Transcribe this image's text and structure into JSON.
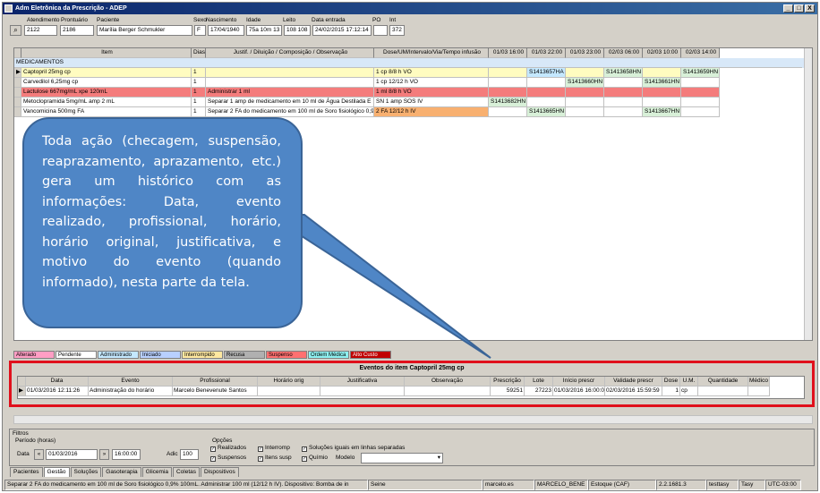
{
  "window": {
    "title": "Adm Eletrônica da Prescrição - ADEP",
    "buttons": [
      "_",
      "□",
      "X"
    ]
  },
  "patient": {
    "labels": [
      "Atendimento",
      "Prontuário",
      "Paciente",
      "Sexo",
      "Nascimento",
      "Idade",
      "Leito",
      "Data entrada",
      "PO",
      "Int"
    ],
    "values": [
      "2122",
      "2186",
      "Marília Berger Schmukler",
      "F",
      "17/04/1940",
      "75a 10m 13",
      "108 108",
      "24/02/2015 17:12:14",
      "",
      "372"
    ]
  },
  "grid": {
    "headers": [
      "",
      "Item",
      "Dias",
      "Justif. / Diluição / Composição / Observação",
      "Dose/UM/Intervalo/Via/Tempo infusão",
      "01/03 16:00",
      "01/03 22:00",
      "01/03 23:00",
      "02/03 06:00",
      "02/03 10:00",
      "02/03 14:00"
    ],
    "section": "MEDICAMENTOS",
    "rows": [
      {
        "marker": "▶",
        "item": "Captopril 25mg cp",
        "dias": "1",
        "justif": "",
        "dose": "1 cp   8/8 h   VO",
        "c1": "",
        "c2": "S1413657HA",
        "c3": "",
        "c4": "S1413658HN",
        "c5": "",
        "c6": "S1413659HN",
        "bg": "#fffcc0"
      },
      {
        "marker": "",
        "item": "Carvedilol 6,25mg cp",
        "dias": "1",
        "justif": "",
        "dose": "1 cp   12/12 h   VO",
        "c1": "",
        "c2": "",
        "c3": "S1413660HN",
        "c4": "",
        "c5": "S1413661HN",
        "c6": "",
        "bg": "#ffffff"
      },
      {
        "marker": "",
        "item": "Lactulose 667mg/mL xpe 120mL",
        "dias": "1",
        "justif": "Administrar 1 ml",
        "dose": "1 ml   8/8 h   VO",
        "c1": "",
        "c2": "",
        "c3": "",
        "c4": "",
        "c5": "",
        "c6": "",
        "bg": "#f47c7c"
      },
      {
        "marker": "",
        "item": "Metoclopramida 5mg/mL amp 2 mL",
        "dias": "1",
        "justif": "Separar 1 amp de medicamento em 10 ml de Água Destilada E",
        "dose": "SN 1 amp   SOS   IV",
        "c1": "S1413682HN",
        "c2": "",
        "c3": "",
        "c4": "",
        "c5": "",
        "c6": "",
        "bg": "#ffffff"
      },
      {
        "marker": "",
        "item": "Vancomicina 500mg FA",
        "dias": "1",
        "justif": "Separar 2 FA do medicamento em 100 ml de Soro fisiológico 0,9",
        "dose": "2 FA   12/12 h   IV",
        "c1": "",
        "c2": "S1413665HN",
        "c3": "",
        "c4": "",
        "c5": "S1413667HN",
        "c6": "",
        "bg": "#ffffff"
      }
    ]
  },
  "callout": {
    "text": "Toda ação (checagem, suspensão, reaprazamento, aprazamento, etc.) gera um histórico com as informações: Data, evento realizado, profissional, horário, horário original, justificativa, e motivo do evento (quando informado), nesta parte da tela."
  },
  "legend": [
    {
      "label": "Alterado",
      "color": "#ff9ec4"
    },
    {
      "label": "Pendente",
      "color": "#ffffff"
    },
    {
      "label": "Administrado",
      "color": "#c4e8ff"
    },
    {
      "label": "Iniciado",
      "color": "#b8d0ff"
    },
    {
      "label": "Interrompido",
      "color": "#ffe8a0"
    },
    {
      "label": "Recusa",
      "color": "#b0b0b0"
    },
    {
      "label": "Suspenso",
      "color": "#ff7070"
    },
    {
      "label": "Ordem Médica",
      "color": "#8ef0f0"
    },
    {
      "label": "Alto Custo",
      "color": "#c00000"
    }
  ],
  "events": {
    "title": "Eventos do item Captopril 25mg cp",
    "headers": [
      "",
      "Data",
      "Evento",
      "Profissional",
      "Horário orig",
      "Justificativa",
      "Observação",
      "Prescrição",
      "Lote",
      "Início prescr",
      "Validade prescr",
      "Dose",
      "U.M.",
      "Quantidade",
      "Médico pr"
    ],
    "row": [
      "▶",
      "01/03/2016 12:11:26",
      "Administração do horário",
      "Marcelo Benevenute Santos",
      "",
      "",
      "",
      "59251",
      "27223",
      "01/03/2016 16:00:00",
      "02/03/2016 15:59:59",
      "1",
      "cp",
      "",
      ""
    ]
  },
  "filters": {
    "group_label": "Filtros",
    "period_label": "Período (horas)",
    "date_label": "Data",
    "date_value": "01/03/2016",
    "time_value": "16:00:00",
    "adic_label": "Adic",
    "adic_value": "100",
    "options_label": "Opções",
    "options": [
      {
        "label": "Realizados",
        "checked": true
      },
      {
        "label": "Interromp",
        "checked": true
      },
      {
        "label": "Soluções iguais em linhas separadas",
        "checked": true
      },
      {
        "label": "Suspensos",
        "checked": true
      },
      {
        "label": "Itens susp",
        "checked": true
      },
      {
        "label": "Químio",
        "checked": true
      }
    ],
    "modelo_label": "Modelo"
  },
  "tabs": [
    "Pacientes",
    "Gestão",
    "Soluções",
    "Gasoterapia",
    "Glicemia",
    "Coletas",
    "Dispositivos"
  ],
  "active_tab": "Gestão",
  "statusbar": [
    "Separar 2 FA do medicamento em 100 ml de Soro fisiológico 0,9% 100mL. Administrar 100 ml (12/12 h IV). Dispositivo: Bomba de in",
    "Seine",
    "marcelo.es",
    "MARCELO_BENE",
    "Estoque (CAF)",
    "2.2.1681.3",
    "testtasy",
    "Tasy",
    "UTC-03:00"
  ]
}
